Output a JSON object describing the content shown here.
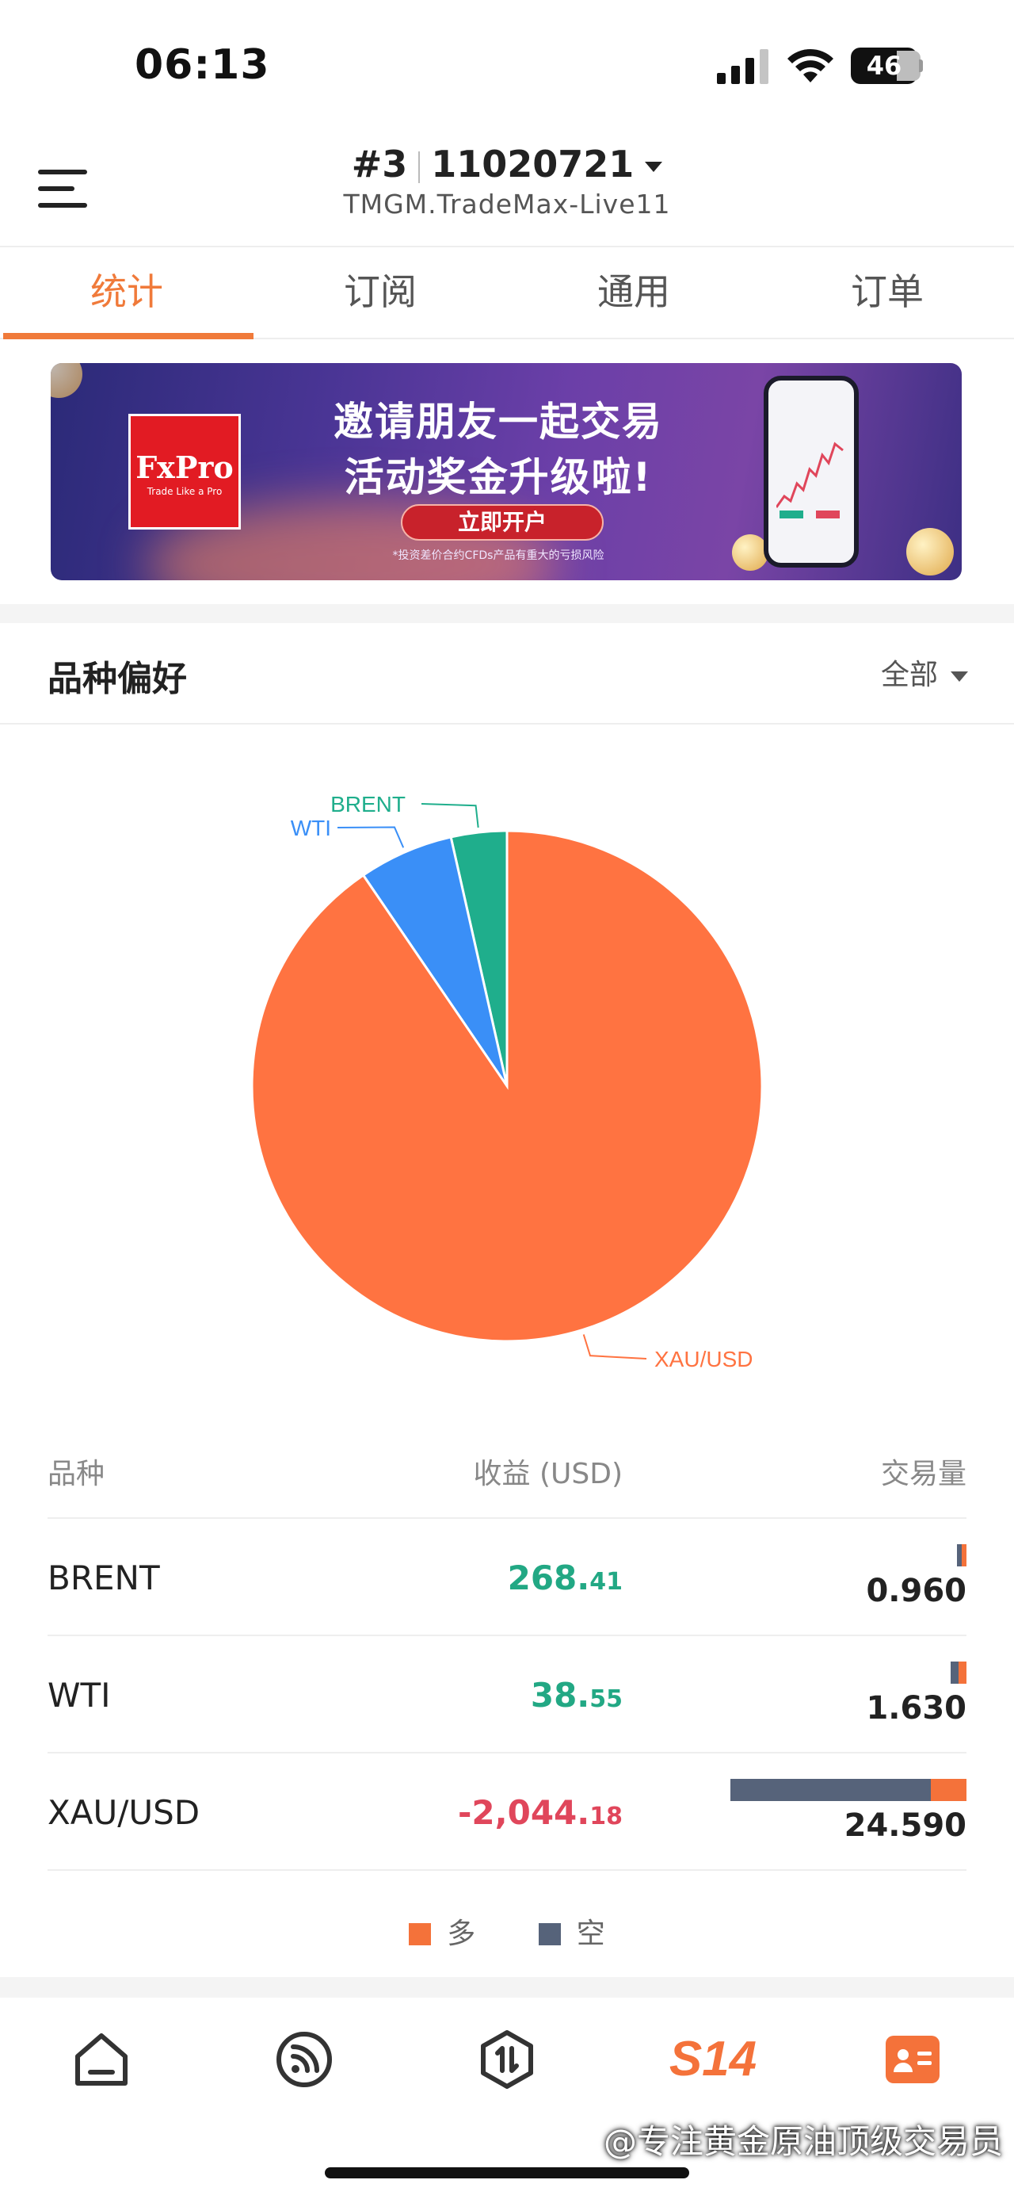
{
  "status_bar": {
    "time": "06:13",
    "battery": "46"
  },
  "header": {
    "account_index": "#3",
    "account_number": "11020721",
    "server": "TMGM.TradeMax-Live11"
  },
  "tabs": [
    {
      "label": "统计",
      "active": true
    },
    {
      "label": "订阅",
      "active": false
    },
    {
      "label": "通用",
      "active": false
    },
    {
      "label": "订单",
      "active": false
    }
  ],
  "banner": {
    "brand": "FxPro",
    "brand_tagline": "Trade Like a Pro",
    "line1": "邀请朋友一起交易",
    "line2": "活动奖金升级啦!",
    "cta": "立即开户",
    "disclaimer": "*投资差价合约CFDs产品有重大的亏损风险"
  },
  "section": {
    "title": "品种偏好",
    "filter": "全部"
  },
  "chart_data": {
    "type": "pie",
    "slices": [
      {
        "label": "XAU/USD",
        "value": 24.59,
        "color": "#ff7341"
      },
      {
        "label": "WTI",
        "value": 1.63,
        "color": "#3a8ff7"
      },
      {
        "label": "BRENT",
        "value": 0.96,
        "color": "#1fae8c"
      }
    ],
    "units": "交易量"
  },
  "table": {
    "headers": {
      "symbol": "品种",
      "profit": "收益 (USD)",
      "volume": "交易量"
    },
    "rows": [
      {
        "symbol": "BRENT",
        "profit_main": "268.",
        "profit_cents": "41",
        "sign": "pos",
        "volume": "0.960",
        "vol_value": 0.96,
        "long_share": 0.5
      },
      {
        "symbol": "WTI",
        "profit_main": "38.",
        "profit_cents": "55",
        "sign": "pos",
        "volume": "1.630",
        "vol_value": 1.63,
        "long_share": 0.5
      },
      {
        "symbol": "XAU/USD",
        "profit_main": "-2,044.",
        "profit_cents": "18",
        "sign": "neg",
        "volume": "24.590",
        "vol_value": 24.59,
        "long_share": 0.15
      }
    ]
  },
  "legend": {
    "long": "多",
    "short": "空",
    "long_color": "#f4723a",
    "short_color": "#56637a"
  },
  "bottom_nav": [
    {
      "name": "home",
      "icon": "home-icon"
    },
    {
      "name": "feed",
      "icon": "rss-icon"
    },
    {
      "name": "trade",
      "icon": "trade-icon"
    },
    {
      "name": "s14",
      "icon": "s14-logo",
      "label": "S14"
    },
    {
      "name": "profile",
      "icon": "id-card-icon"
    }
  ],
  "watermark": "@专注黄金原油顶级交易员"
}
